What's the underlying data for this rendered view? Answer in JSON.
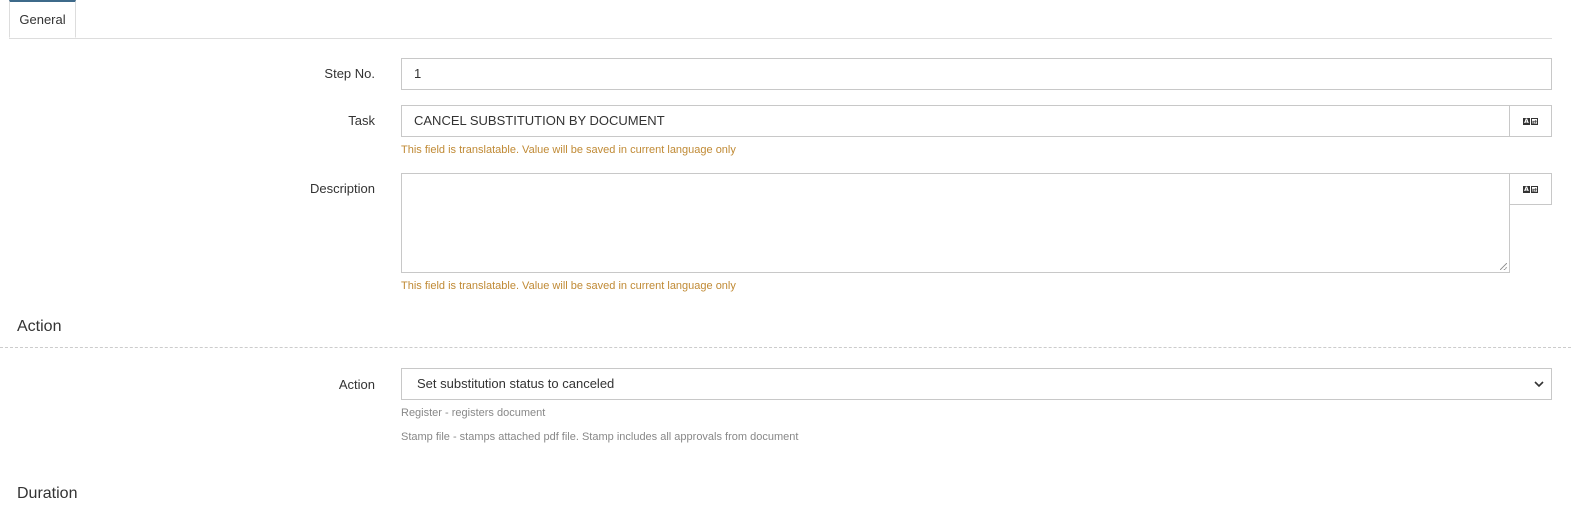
{
  "tabs": [
    {
      "label": "General",
      "active": true
    }
  ],
  "form": {
    "step_no": {
      "label": "Step No.",
      "value": "1"
    },
    "task": {
      "label": "Task",
      "value": "CANCEL SUBSTITUTION BY DOCUMENT",
      "hint": "This field is translatable. Value will be saved in current language only"
    },
    "description": {
      "label": "Description",
      "value": "",
      "hint": "This field is translatable. Value will be saved in current language only"
    }
  },
  "action_section": {
    "title": "Action",
    "field_label": "Action",
    "selected": "Set substitution status to canceled",
    "help": [
      "Register - registers document",
      "Stamp file - stamps attached pdf file. Stamp includes all approvals from document"
    ]
  },
  "duration_section": {
    "title": "Duration"
  },
  "icons": {
    "translate": "translate-icon",
    "dropdown": "chevron-down-icon"
  },
  "colors": {
    "tab_accent": "#3e6a8a",
    "hint_warning": "#c08a35",
    "hint_muted": "#888888",
    "border": "#c8c8c8"
  }
}
